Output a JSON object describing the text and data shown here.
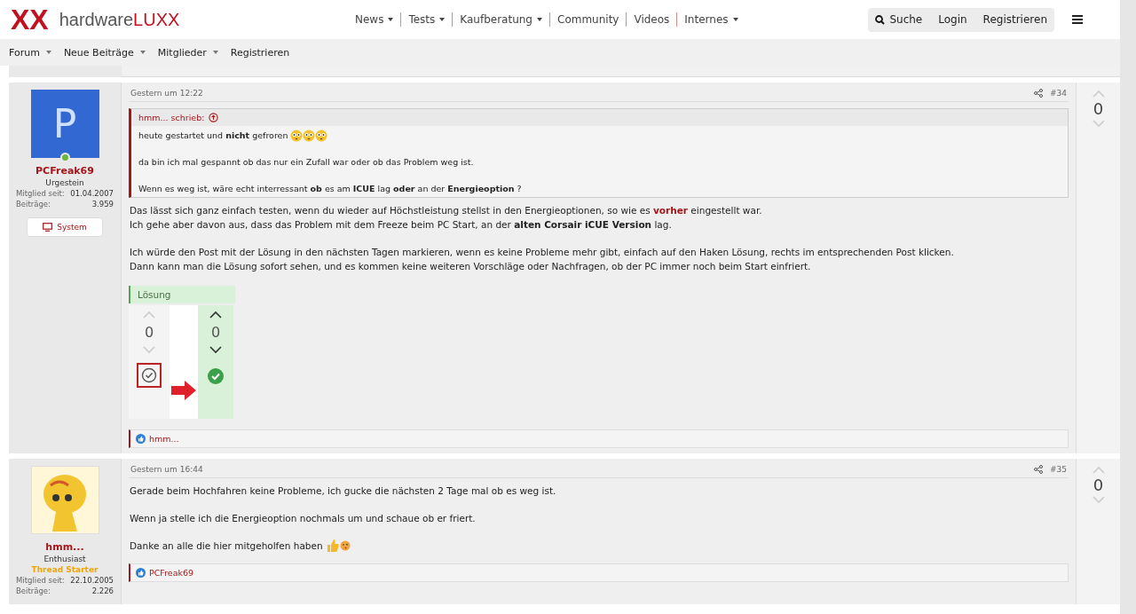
{
  "header": {
    "logo_mark": "XX",
    "logo_word": "hardware",
    "logo_word_accent": "LUXX",
    "nav": [
      {
        "label": "News",
        "dropdown": true
      },
      {
        "label": "Tests",
        "dropdown": true
      },
      {
        "label": "Kaufberatung",
        "dropdown": true
      },
      {
        "label": "Community",
        "dropdown": false
      },
      {
        "label": "Videos",
        "dropdown": false
      },
      {
        "label": "Internes",
        "dropdown": true
      }
    ],
    "search": "Suche",
    "login": "Login",
    "register": "Registrieren"
  },
  "subnav": [
    {
      "label": "Forum",
      "dropdown": true
    },
    {
      "label": "Neue Beiträge",
      "dropdown": true
    },
    {
      "label": "Mitglieder",
      "dropdown": true
    },
    {
      "label": "Registrieren",
      "dropdown": false
    }
  ],
  "posts": [
    {
      "author": "PCFreak69",
      "avatar": {
        "kind": "letter",
        "letter": "P"
      },
      "online": true,
      "role": "Urgestein",
      "stats": [
        {
          "label": "Mitglied seit:",
          "value": "01.04.2007"
        },
        {
          "label": "Beiträge:",
          "value": "3.959"
        }
      ],
      "system_button": "System",
      "date": "Gestern um 12:22",
      "number": "#34",
      "score": "0",
      "quote": {
        "author": "hmm... schrieb:",
        "lines": [
          [
            {
              "text": "heute gestartet und ",
              "kind": "plain"
            },
            {
              "text": "nicht",
              "kind": "bold"
            },
            {
              "text": " gefroren ",
              "kind": "plain"
            },
            {
              "kind": "flushed"
            },
            {
              "kind": "flushed"
            },
            {
              "kind": "flushed"
            }
          ],
          [
            {
              "text": "da bin ich mal gespannt ob das nur ein Zufall war oder ob das Problem weg ist.",
              "kind": "plain"
            }
          ],
          [
            {
              "text": "Wenn es weg ist, wäre echt interressant ",
              "kind": "plain"
            },
            {
              "text": "ob",
              "kind": "bold"
            },
            {
              "text": " es am ",
              "kind": "plain"
            },
            {
              "text": "ICUE",
              "kind": "bold"
            },
            {
              "text": " lag ",
              "kind": "plain"
            },
            {
              "text": "oder",
              "kind": "bold"
            },
            {
              "text": " an der ",
              "kind": "plain"
            },
            {
              "text": "Energieoption",
              "kind": "bold"
            },
            {
              "text": " ?",
              "kind": "plain"
            }
          ]
        ]
      },
      "paragraphs": [
        [
          [
            {
              "text": "Das lässt sich ganz einfach testen, wenn du wieder auf Höchstleistung stellst in den Energieoptionen, so wie es ",
              "kind": "plain"
            },
            {
              "text": "vorher",
              "kind": "highlight"
            },
            {
              "text": " eingestellt war.",
              "kind": "plain"
            }
          ],
          [
            {
              "text": "Ich gehe aber davon aus, dass das Problem mit dem Freeze beim PC Start, an der ",
              "kind": "plain"
            },
            {
              "text": "alten Corsair iCUE Version",
              "kind": "bold"
            },
            {
              "text": " lag.",
              "kind": "plain"
            }
          ]
        ],
        [
          [
            {
              "text": "Ich würde den Post mit der Lösung in den nächsten Tagen markieren, wenn es keine Probleme mehr gibt, einfach auf den Haken Lösung, rechts im entsprechenden Post klicken.",
              "kind": "plain"
            }
          ],
          [
            {
              "text": "Dann kann man die Lösung sofort sehen, und es kommen keine weiteren Vorschläge oder Nachfragen, ob der PC immer noch beim Start einfriert.",
              "kind": "plain"
            }
          ]
        ]
      ],
      "solution": {
        "label": "Lösung",
        "left_score": "0",
        "right_score": "0"
      },
      "reactions": "hmm..."
    },
    {
      "author": "hmm...",
      "avatar": {
        "kind": "image"
      },
      "online": false,
      "role": "Enthusiast",
      "starter": "Thread Starter",
      "stats": [
        {
          "label": "Mitglied seit:",
          "value": "22.10.2005"
        },
        {
          "label": "Beiträge:",
          "value": "2.226"
        }
      ],
      "date": "Gestern um 16:44",
      "number": "#35",
      "score": "0",
      "paragraphs": [
        [
          [
            {
              "text": "Gerade beim Hochfahren keine Probleme, ich gucke die nächsten 2 Tage mal ob es weg ist.",
              "kind": "plain"
            }
          ]
        ],
        [
          [
            {
              "text": "Wenn ja stelle ich die Energieoption nochmals um und schaue ob er friert.",
              "kind": "plain"
            }
          ]
        ],
        [
          [
            {
              "text": "Danke an alle die hier mitgeholfen haben ",
              "kind": "plain"
            },
            {
              "kind": "thumbsup"
            },
            {
              "kind": "kiss"
            }
          ]
        ]
      ],
      "reactions": "PCFreak69"
    }
  ]
}
